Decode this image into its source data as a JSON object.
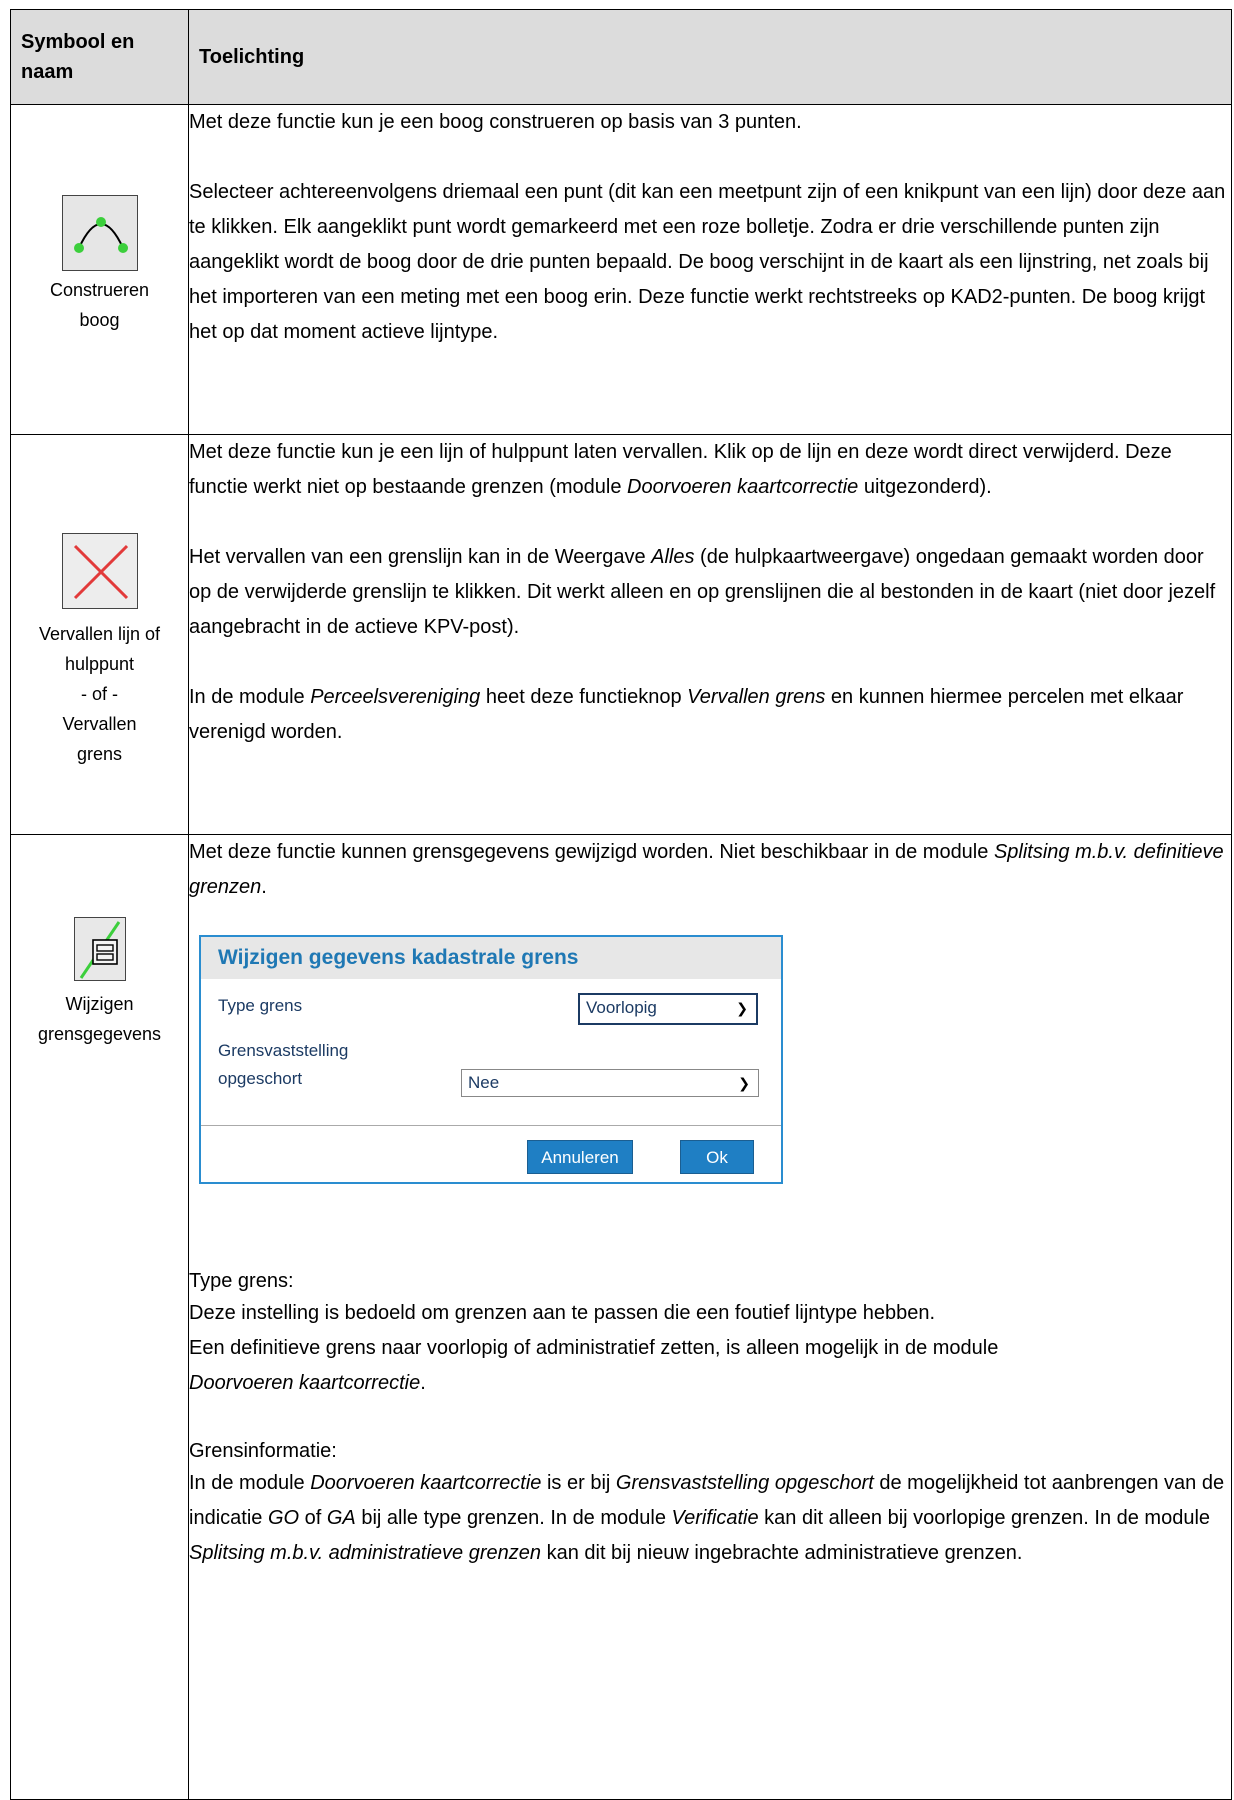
{
  "header": {
    "col1": "Symbool en naam",
    "col2": "Toelichting"
  },
  "rows": [
    {
      "icon": "arc-construct-icon",
      "name_lines": [
        "Construeren",
        "boog"
      ],
      "paragraphs": [
        "Met deze functie kun je een boog construeren op basis van 3 punten.",
        "Selecteer achtereenvolgens driemaal een punt (dit kan een meetpunt zijn of een knikpunt van een lijn) door deze aan te klikken. Elk aangeklikt punt wordt gemarkeerd met een roze bolletje. Zodra er drie verschillende punten zijn aangeklikt wordt de boog door de drie punten bepaald. De boog verschijnt in de kaart als een lijnstring, net zoals bij het importeren van een meting met een boog erin. Deze functie werkt rechtstreeks op KAD2-punten. De boog krijgt het op dat moment actieve lijntype."
      ]
    },
    {
      "icon": "red-x-icon",
      "name_lines": [
        "Vervallen lijn of",
        "hulppunt",
        "- of -",
        "Vervallen",
        "grens"
      ],
      "p1a": "Met deze functie kun je een lijn of hulppunt laten vervallen. Klik op de lijn en deze wordt direct verwijderd. Deze functie werkt niet op bestaande grenzen (module ",
      "p1b": "Doorvoeren kaartcorrectie",
      "p1c": " uitgezonderd).",
      "p2a": "Het vervallen van een grenslijn kan in de Weergave ",
      "p2b": "Alles",
      "p2c": " (de hulpkaartweergave) ongedaan gemaakt worden door op de verwijderde grenslijn te klikken. Dit werkt alleen en op grenslijnen die al bestonden in de kaart (niet door jezelf aangebracht in de actieve KPV-post).",
      "p3a": "In de module ",
      "p3b": "Perceelsvereniging",
      "p3c": " heet deze functieknop ",
      "p3d": "Vervallen grens",
      "p3e": " en kunnen hiermee percelen met elkaar verenigd worden."
    },
    {
      "icon": "edit-boundary-data-icon",
      "name_lines": [
        "Wijzigen",
        "grensgegevens"
      ],
      "p1a": "Met deze functie kunnen grensgegevens gewijzigd worden. Niet beschikbaar in de module ",
      "p1b": "Splitsing m.b.v. definitieve grenzen",
      "p1c": ".",
      "dialog": {
        "title": "Wijzigen gegevens kadastrale grens",
        "type_label": "Type grens",
        "type_value": "Voorlopig",
        "suspend_label_1": "Grensvaststelling",
        "suspend_label_2": "opgeschort",
        "suspend_value": "Nee",
        "cancel": "Annuleren",
        "ok": "Ok"
      },
      "type_heading": "Type grens:",
      "type_line1": "Deze instelling is bedoeld om grenzen aan te passen die een foutief lijntype hebben.",
      "type_line2": "Een definitieve grens naar voorlopig of administratief zetten, is alleen mogelijk in de module",
      "type_line3a": "Doorvoeren kaartcorrectie",
      "type_line3b": ".",
      "info_heading": "Grensinformatie:",
      "i1": "In de module ",
      "i2": "Doorvoeren kaartcorrectie",
      "i3": " is er bij ",
      "i4": "Grensvaststelling opgeschort",
      "i5": " de mogelijkheid tot aanbrengen van de indicatie ",
      "i6": "GO",
      "i7": " of ",
      "i8": "GA",
      "i9": " bij alle type grenzen. In de module ",
      "i10": "Verificatie",
      "i11": " kan dit alleen bij voorlopige grenzen. In de module ",
      "i12": "Splitsing m.b.v. administratieve grenzen",
      "i13": " kan dit bij nieuw ingebrachte administratieve grenzen."
    }
  ],
  "colors": {
    "point_green": "#3ccf3c",
    "cross_red": "#e23a3a",
    "dialog_title": "#1f78b4",
    "button_blue": "#1f7fc4"
  }
}
